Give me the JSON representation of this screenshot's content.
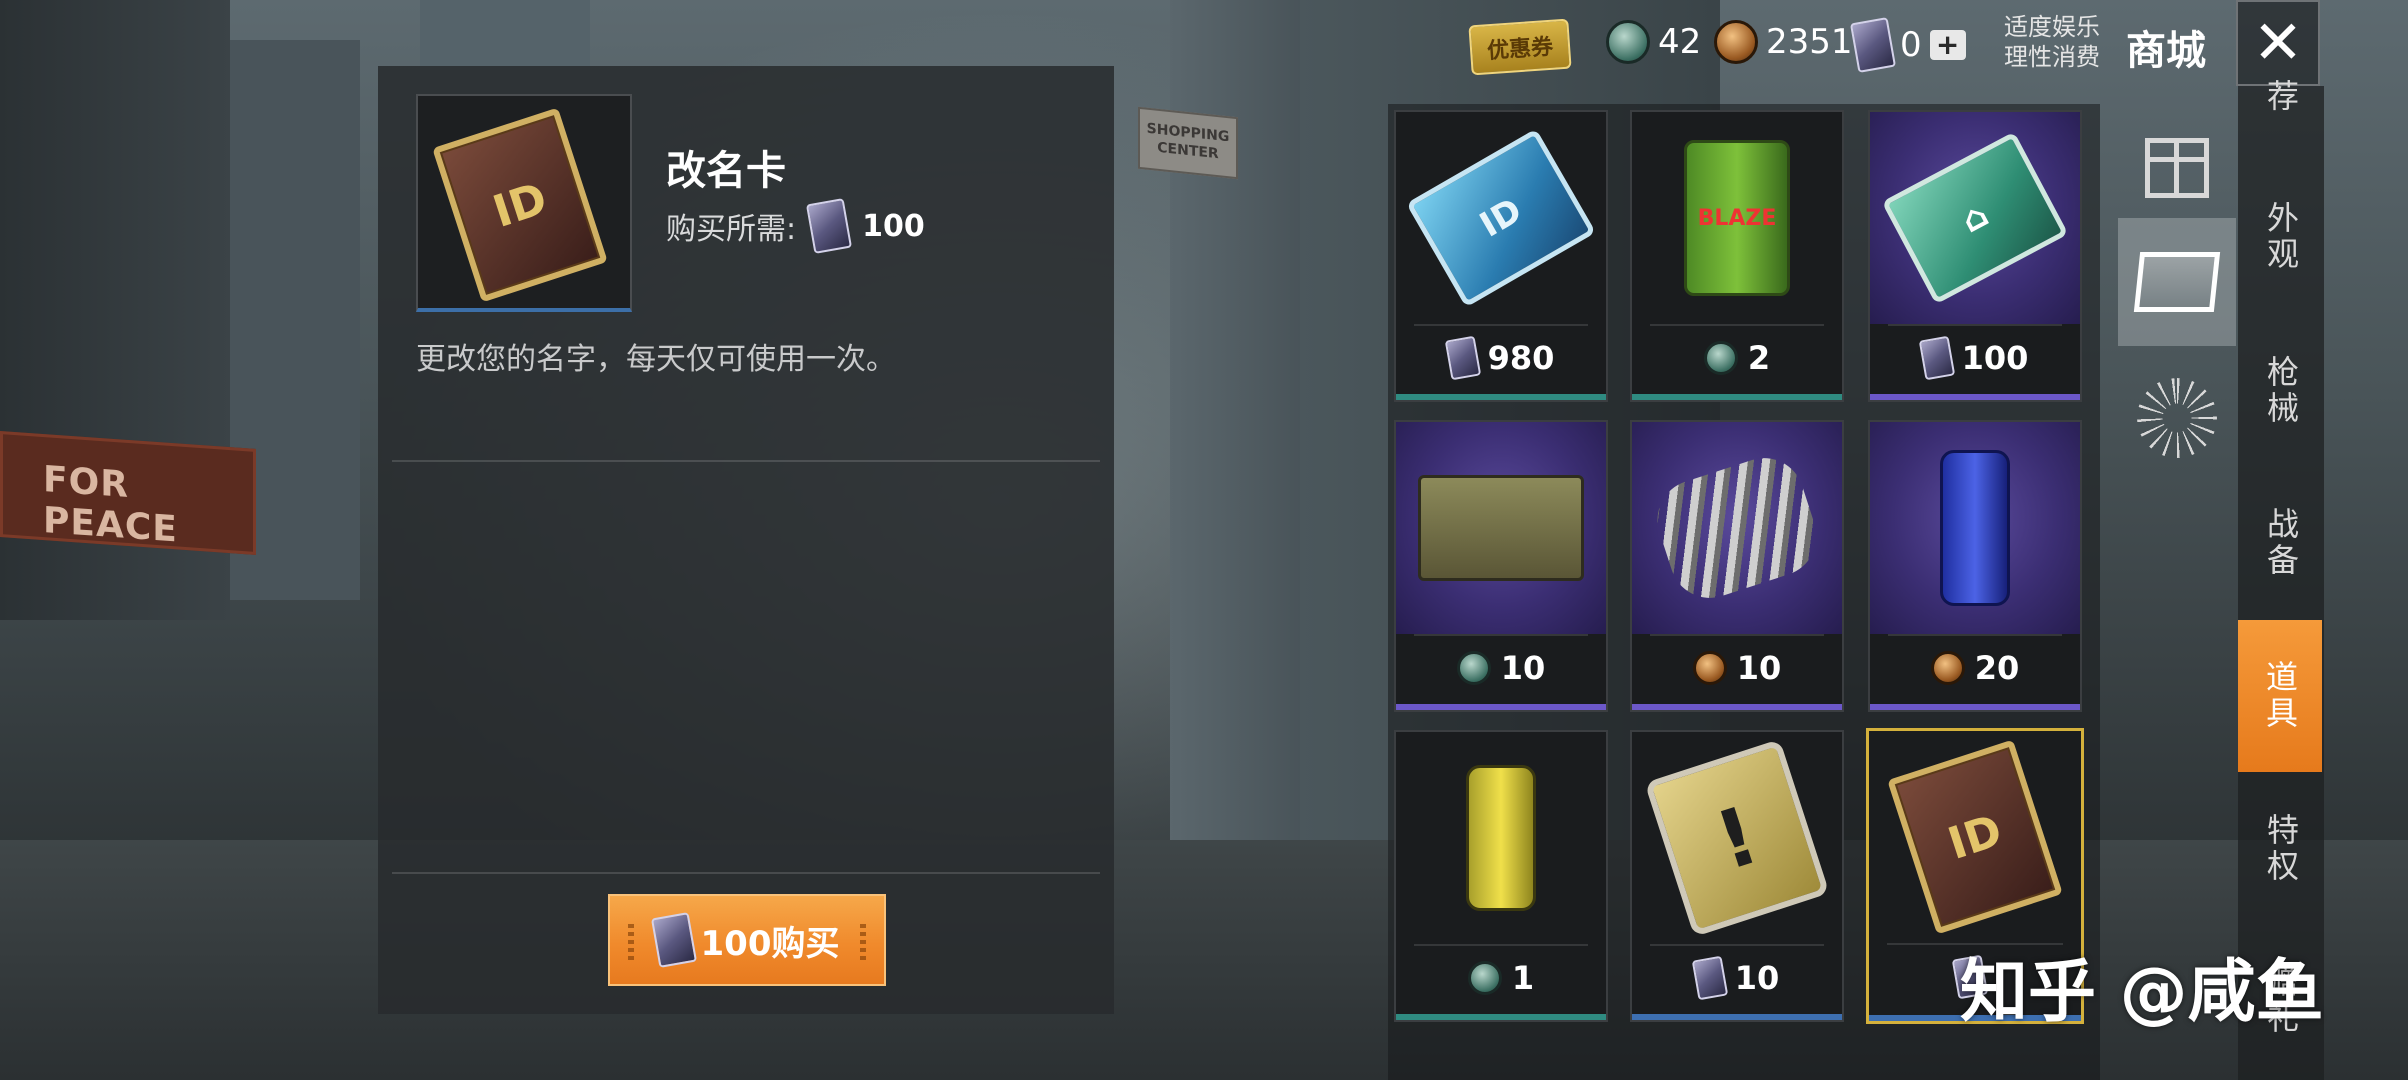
{
  "header": {
    "coupon_label": "优惠券",
    "currencies": [
      {
        "icon": "green-coin-icon",
        "value": "42"
      },
      {
        "icon": "bronze-coin-icon",
        "value": "2351"
      },
      {
        "icon": "ticket-icon",
        "value": "0"
      }
    ],
    "tips_line1": "适度娱乐",
    "tips_line2": "理性消费",
    "title": "商城",
    "close_label": "✕"
  },
  "background": {
    "sign_left": "FOR PEACE",
    "sign_right": "SHOPPING CENTER"
  },
  "detail": {
    "name": "改名卡",
    "price_label": "购买所需:",
    "price_value": "100",
    "description": "更改您的名字，每天仅可使用一次。",
    "buy_label": "100购买",
    "thumb_glyph": "ID"
  },
  "items": [
    {
      "art": "blue-id-card",
      "glyph": "ID",
      "price": "980",
      "currency": "ticket",
      "rarity": "teal"
    },
    {
      "art": "jerry-can",
      "glyph": "BLAZE",
      "price": "2",
      "currency": "green-coin",
      "rarity": "teal"
    },
    {
      "art": "green-card",
      "glyph": "⌂",
      "price": "100",
      "currency": "ticket",
      "rarity": "purple"
    },
    {
      "art": "toolbox",
      "glyph": "",
      "price": "10",
      "currency": "green-coin",
      "rarity": "purple"
    },
    {
      "art": "spring",
      "glyph": "",
      "price": "10",
      "currency": "bronze-coin",
      "rarity": "purple"
    },
    {
      "art": "spray-can",
      "glyph": "",
      "price": "20",
      "currency": "bronze-coin",
      "rarity": "purple"
    },
    {
      "art": "canister",
      "glyph": "",
      "price": "1",
      "currency": "green-coin",
      "rarity": "teal"
    },
    {
      "art": "warning-card",
      "glyph": "!",
      "price": "10",
      "currency": "ticket",
      "rarity": "blue"
    },
    {
      "art": "rename-card",
      "glyph": "ID",
      "price": "",
      "currency": "ticket",
      "rarity": "blue",
      "selected": true
    }
  ],
  "side_icons": [
    "gift-icon",
    "crate-icon",
    "firework-icon"
  ],
  "tabs": [
    "荐",
    "外观",
    "枪械",
    "战备",
    "道具",
    "特权",
    "赠礼"
  ],
  "active_tab": "道具",
  "watermark": "知乎 @咸鱼",
  "colors": {
    "accent": "#f08a2c",
    "selected_border": "#d4b13c",
    "teal": "#2f8b81",
    "purple": "#6c58c9",
    "blue": "#3d6fb1"
  }
}
